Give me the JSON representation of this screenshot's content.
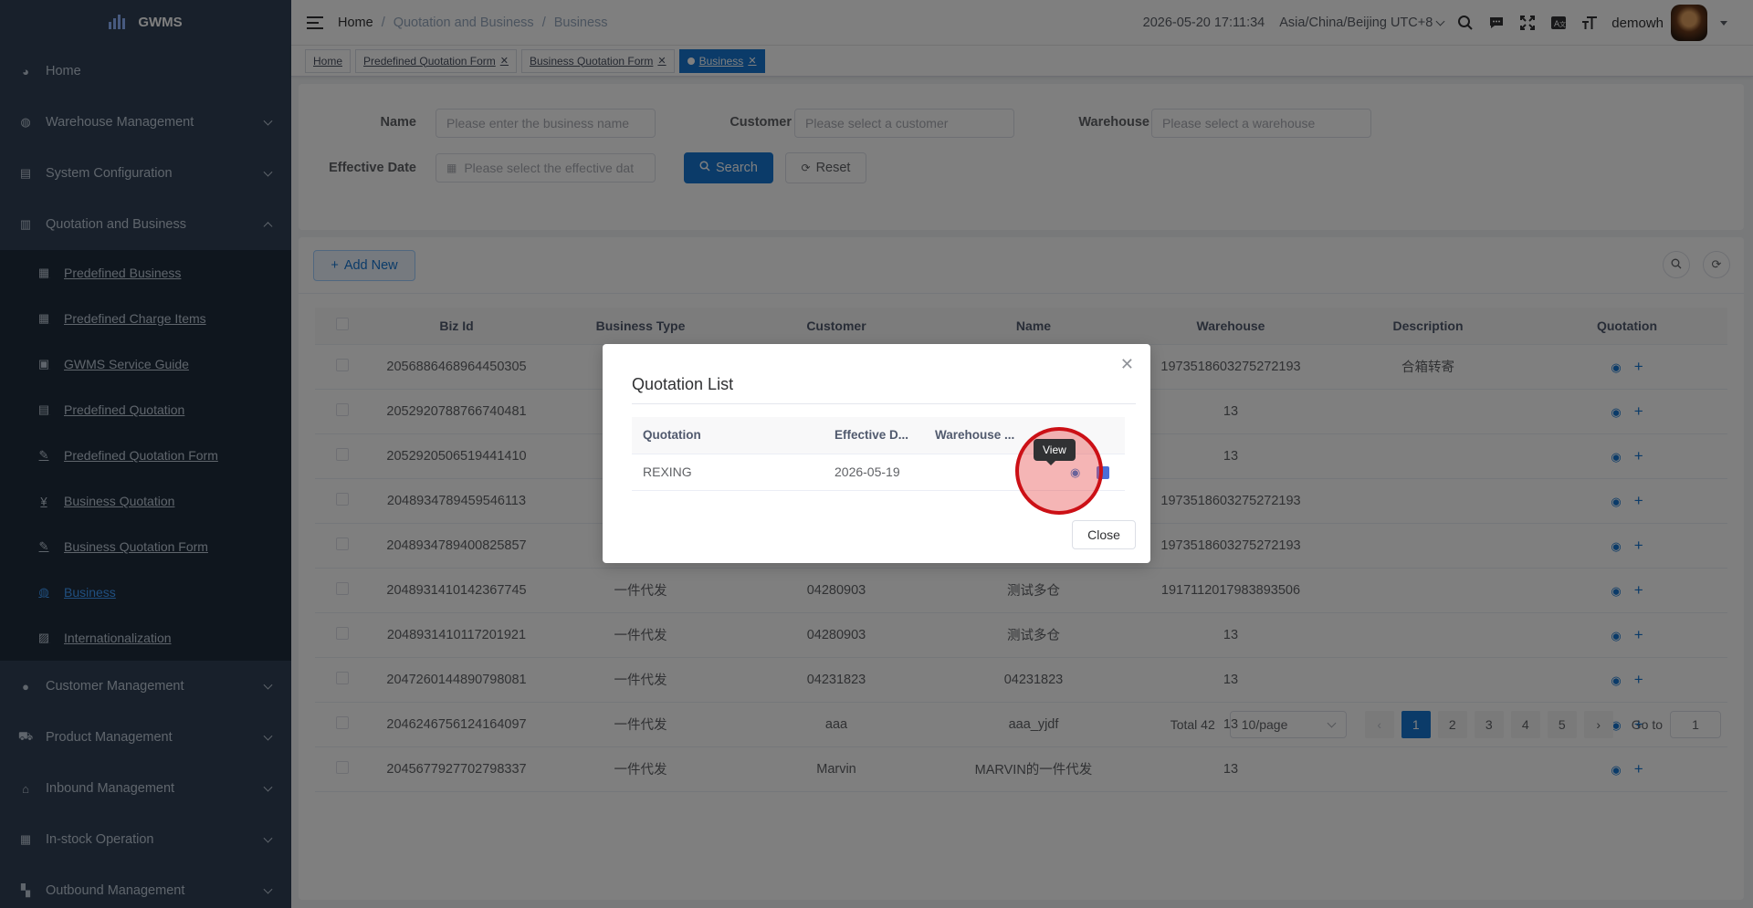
{
  "app": {
    "logo_text": "GWMS"
  },
  "sidebar": {
    "top_items": [
      {
        "label": "Home",
        "icon": "dashboard-icon"
      },
      {
        "label": "Warehouse Management",
        "icon": "globe-icon"
      },
      {
        "label": "System Configuration",
        "icon": "document-icon"
      },
      {
        "label": "Quotation and Business",
        "icon": "clipboard-icon"
      }
    ],
    "sub_items": [
      {
        "label": "Predefined Business",
        "icon": "calendar-icon"
      },
      {
        "label": "Predefined Charge Items",
        "icon": "table-icon"
      },
      {
        "label": "GWMS Service Guide",
        "icon": "guide-icon"
      },
      {
        "label": "Predefined Quotation",
        "icon": "document-icon"
      },
      {
        "label": "Predefined Quotation Form",
        "icon": "edit-icon"
      },
      {
        "label": "Business Quotation",
        "icon": "yen-icon"
      },
      {
        "label": "Business Quotation Form",
        "icon": "edit-icon"
      },
      {
        "label": "Business",
        "icon": "globe-icon"
      },
      {
        "label": "Internationalization",
        "icon": "translate-icon"
      }
    ],
    "bottom_items": [
      {
        "label": "Customer Management",
        "icon": "user-icon"
      },
      {
        "label": "Product Management",
        "icon": "cart-icon"
      },
      {
        "label": "Inbound Management",
        "icon": "home-icon"
      },
      {
        "label": "In-stock Operation",
        "icon": "grid-icon"
      },
      {
        "label": "Outbound Management",
        "icon": "tiles-icon"
      }
    ]
  },
  "header": {
    "breadcrumb": [
      "Home",
      "Quotation and Business",
      "Business"
    ],
    "datetime": "2026-05-20 17:11:34",
    "timezone": "Asia/China/Beijing UTC+8",
    "username": "demowh"
  },
  "tags": [
    {
      "label": "Home"
    },
    {
      "label": "Predefined Quotation Form"
    },
    {
      "label": "Business Quotation Form"
    },
    {
      "label": "Business"
    }
  ],
  "search": {
    "name_label": "Name",
    "name_placeholder": "Please enter the business name",
    "customer_label": "Customer",
    "customer_placeholder": "Please select a customer",
    "warehouse_label": "Warehouse",
    "warehouse_placeholder": "Please select a warehouse",
    "date_label": "Effective Date",
    "date_placeholder": "Please select the effective dat",
    "search_btn": "Search",
    "reset_btn": "Reset"
  },
  "toolbar": {
    "add_btn": "Add New"
  },
  "table": {
    "headers": [
      "Biz Id",
      "Business Type",
      "Customer",
      "Name",
      "Warehouse",
      "Description",
      "Quotation"
    ],
    "rows": [
      {
        "id": "2056886468964450305",
        "type": "",
        "customer": "",
        "name": "",
        "warehouse": "1973518603275272193",
        "desc": "合箱转寄"
      },
      {
        "id": "2052920788766740481",
        "type": "",
        "customer": "",
        "name": "",
        "warehouse": "13",
        "desc": ""
      },
      {
        "id": "2052920506519441410",
        "type": "",
        "customer": "",
        "name": "",
        "warehouse": "13",
        "desc": ""
      },
      {
        "id": "2048934789459546113",
        "type": "",
        "customer": "",
        "name": "",
        "warehouse": "1973518603275272193",
        "desc": ""
      },
      {
        "id": "2048934789400825857",
        "type": "",
        "customer": "",
        "name": "",
        "warehouse": "1973518603275272193",
        "desc": ""
      },
      {
        "id": "2048931410142367745",
        "type": "一件代发",
        "customer": "04280903",
        "name": "测试多仓",
        "warehouse": "1917112017983893506",
        "desc": ""
      },
      {
        "id": "2048931410117201921",
        "type": "一件代发",
        "customer": "04280903",
        "name": "测试多仓",
        "warehouse": "13",
        "desc": ""
      },
      {
        "id": "2047260144890798081",
        "type": "一件代发",
        "customer": "04231823",
        "name": "04231823",
        "warehouse": "13",
        "desc": ""
      },
      {
        "id": "2046246756124164097",
        "type": "一件代发",
        "customer": "aaa",
        "name": "aaa_yjdf",
        "warehouse": "13",
        "desc": ""
      },
      {
        "id": "2045677927702798337",
        "type": "一件代发",
        "customer": "Marvin",
        "name": "MARVIN的一件代发",
        "warehouse": "13",
        "desc": ""
      }
    ]
  },
  "pagination": {
    "total": "Total 42",
    "page_size": "10/page",
    "pages": [
      "1",
      "2",
      "3",
      "4",
      "5"
    ],
    "goto_label": "Go to",
    "goto_value": "1"
  },
  "dialog": {
    "title": "Quotation List",
    "headers": [
      "Quotation",
      "Effective D...",
      "Warehouse ..."
    ],
    "rows": [
      {
        "quotation": "REXING",
        "date": "2026-05-19",
        "warehouse": ""
      }
    ],
    "tooltip": "View",
    "close_btn": "Close"
  },
  "colors": {
    "sidebar_bg": "#304156",
    "submenu_bg": "#1f2d3d",
    "primary": "#1677d2",
    "highlight": "#cc1016"
  }
}
